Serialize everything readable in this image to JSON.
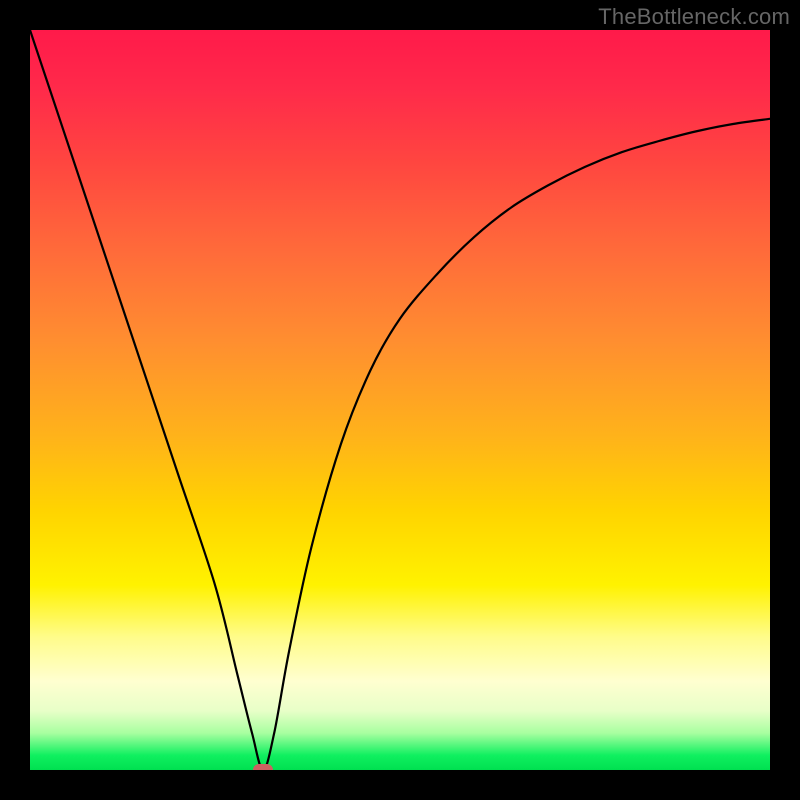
{
  "watermark": "TheBottleneck.com",
  "colors": {
    "frame": "#000000",
    "curve_stroke": "#000000",
    "marker_fill": "#cc6161"
  },
  "chart_data": {
    "type": "line",
    "title": "",
    "xlabel": "",
    "ylabel": "",
    "xlim": [
      0,
      100
    ],
    "ylim": [
      0,
      100
    ],
    "grid": false,
    "legend": false,
    "series": [
      {
        "name": "curve",
        "x": [
          0,
          5,
          10,
          15,
          20,
          25,
          28,
          30,
          31.5,
          33,
          35,
          38,
          42,
          46,
          50,
          55,
          60,
          65,
          70,
          75,
          80,
          85,
          90,
          95,
          100
        ],
        "y": [
          100,
          85,
          70,
          55,
          40,
          25,
          13,
          5,
          0,
          5,
          16,
          30,
          44,
          54,
          61,
          67,
          72,
          76,
          79,
          81.5,
          83.5,
          85,
          86.3,
          87.3,
          88
        ]
      }
    ],
    "marker": {
      "x": 31.5,
      "y": 0
    }
  }
}
